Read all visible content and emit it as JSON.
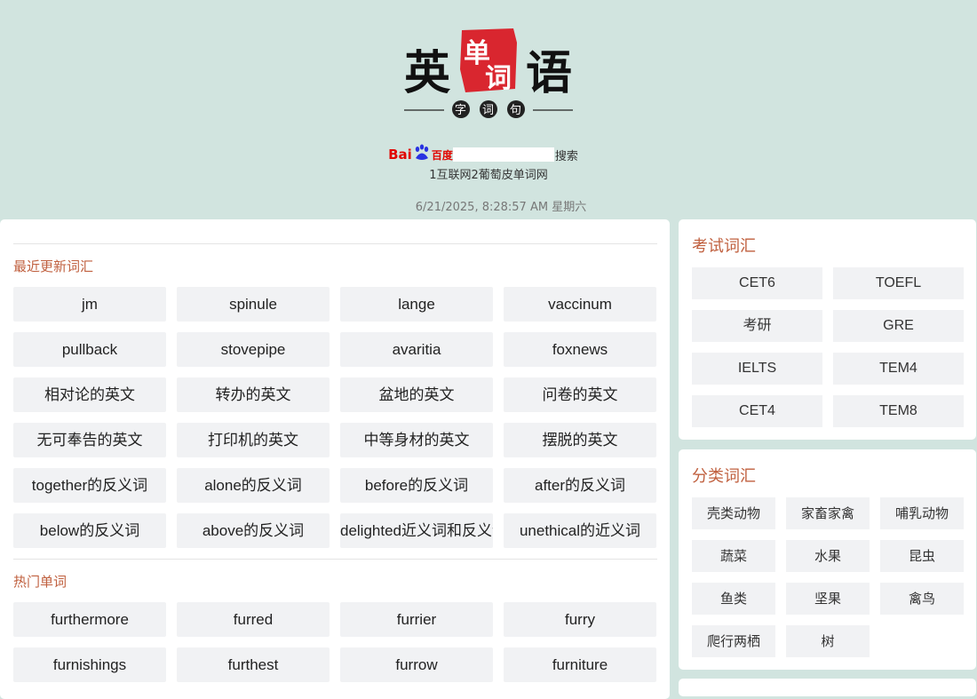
{
  "logo": {
    "chars_main": [
      "英",
      "语"
    ],
    "chars_seal": [
      "单",
      "词"
    ],
    "chars_sub": [
      "字",
      "词",
      "句"
    ],
    "seal_color": "#d9262f"
  },
  "search": {
    "brand_bai": "Bai",
    "brand_du": "百度",
    "button_label": "搜索",
    "input_value": ""
  },
  "site_link": "1互联网2葡萄皮单词网",
  "datetime": "6/21/2025, 8:28:57 AM 星期六",
  "main": {
    "recent_title": "最近更新词汇",
    "recent_words": [
      "jm",
      "spinule",
      "lange",
      "vaccinum",
      "pullback",
      "stovepipe",
      "avaritia",
      "foxnews",
      "相对论的英文",
      "转办的英文",
      "盆地的英文",
      "问卷的英文",
      "无可奉告的英文",
      "打印机的英文",
      "中等身材的英文",
      "摆脱的英文",
      "together的反义词",
      "alone的反义词",
      "before的反义词",
      "after的反义词",
      "below的反义词",
      "above的反义词",
      "delighted近义词和反义词",
      "unethical的近义词"
    ],
    "hot_title": "热门单词",
    "hot_words": [
      "furthermore",
      "furred",
      "furrier",
      "furry",
      "furnishings",
      "furthest",
      "furrow",
      "furniture"
    ]
  },
  "exam": {
    "title": "考试词汇",
    "items": [
      "CET6",
      "TOEFL",
      "考研",
      "GRE",
      "IELTS",
      "TEM4",
      "CET4",
      "TEM8"
    ]
  },
  "category": {
    "title": "分类词汇",
    "items": [
      "壳类动物",
      "家畜家禽",
      "哺乳动物",
      "蔬菜",
      "水果",
      "昆虫",
      "鱼类",
      "坚果",
      "禽鸟",
      "爬行两栖",
      "树"
    ]
  },
  "colors": {
    "background": "#d1e4df",
    "accent": "#c0603f",
    "tile": "#f1f2f4"
  }
}
